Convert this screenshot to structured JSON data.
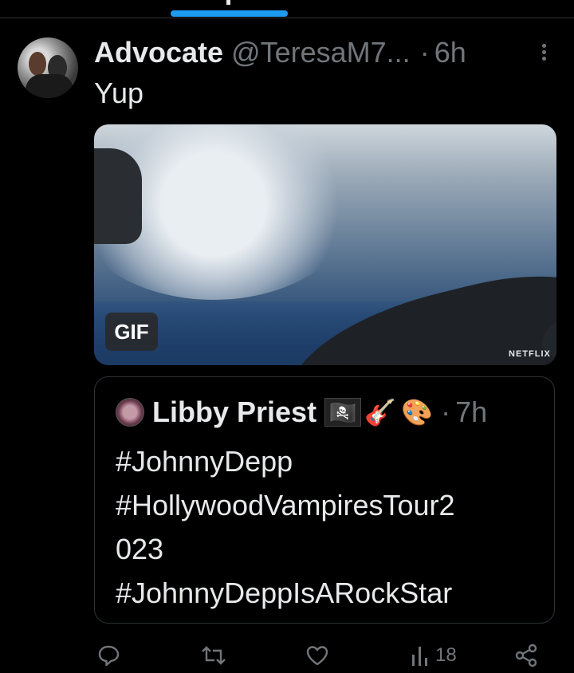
{
  "tweet": {
    "author_name": "Advocate",
    "author_handle": "@TeresaM7...",
    "separator": "·",
    "time": "6h",
    "text": "Yup",
    "media": {
      "badge": "GIF",
      "watermark": "NETFLIX"
    }
  },
  "quote": {
    "author_name": "Libby Priest",
    "emojis": [
      "🏴‍☠️",
      "🎸",
      "🎨"
    ],
    "separator": "·",
    "time": "7h",
    "lines": [
      "#JohnnyDepp",
      "#HollywoodVampiresTour2",
      "023",
      "#JohnnyDeppIsARockStar"
    ]
  },
  "actions": {
    "views": "18"
  },
  "icons": {
    "reply": "reply-icon",
    "retweet": "retweet-icon",
    "like": "heart-icon",
    "views": "views-icon",
    "share": "share-icon",
    "more": "more-icon"
  },
  "colors": {
    "background": "#000000",
    "text": "#e7e9ea",
    "muted": "#71767b",
    "accent": "#1d9bf0",
    "border": "#2f3336"
  }
}
